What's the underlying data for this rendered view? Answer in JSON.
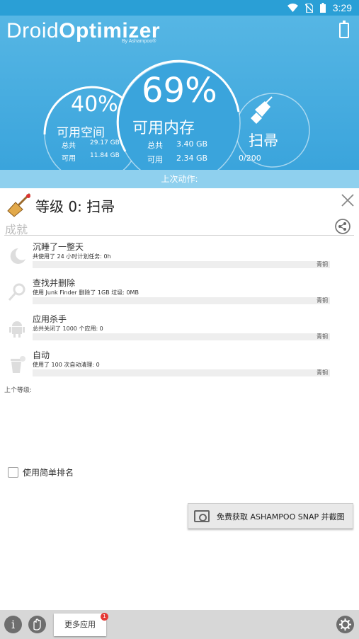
{
  "status": {
    "time": "3:29"
  },
  "app": {
    "name_light": "Droid",
    "name_bold": "Optimizer",
    "by": "By Ashampoo®"
  },
  "space": {
    "percent": "40%",
    "label": "可用空间",
    "total_label": "总共",
    "total_value": "29.17 GB",
    "free_label": "可用",
    "free_value": "11.84 GB"
  },
  "memory": {
    "percent": "69%",
    "label": "可用内存",
    "total_label": "总共",
    "total_value": "3.40 GB",
    "free_label": "可用",
    "free_value": "2.34 GB"
  },
  "sweep": {
    "label": "扫帚",
    "count": "0/200"
  },
  "last_action": "上次动作:",
  "level": {
    "title": "等级 0: 扫帚",
    "achievements_label": "成就",
    "previous_label": "上个等级:"
  },
  "achievements": [
    {
      "icon": "moon-icon",
      "title": "沉睡了一整天",
      "desc": "共使用了 24 小时计划任务: 0h",
      "status": "青铜",
      "progress": 0
    },
    {
      "icon": "magnifier-icon",
      "title": "查找并删除",
      "desc": "使用 Junk Finder 删除了 1GB 垃圾: 0MB",
      "status": "青铜",
      "progress": 0
    },
    {
      "icon": "android-icon",
      "title": "应用杀手",
      "desc": "总共关闭了 1000 个应用: 0",
      "status": "青铜",
      "progress": 0
    },
    {
      "icon": "recycle-bin-icon",
      "title": "自动",
      "desc": "使用了 100 次自动清理: 0",
      "status": "青铜",
      "progress": 0
    }
  ],
  "simple_ranking": {
    "label": "使用简单排名",
    "checked": false
  },
  "snap_button": {
    "label": "免费获取 ASHAMPOO SNAP 并截图"
  },
  "bottom": {
    "more_apps": "更多应用",
    "badge": "1"
  },
  "colors": {
    "header": "#3aa4dc",
    "statusbar": "#2a9fd6",
    "last_action_bar": "#8fd0ee",
    "badge": "#e53935"
  }
}
